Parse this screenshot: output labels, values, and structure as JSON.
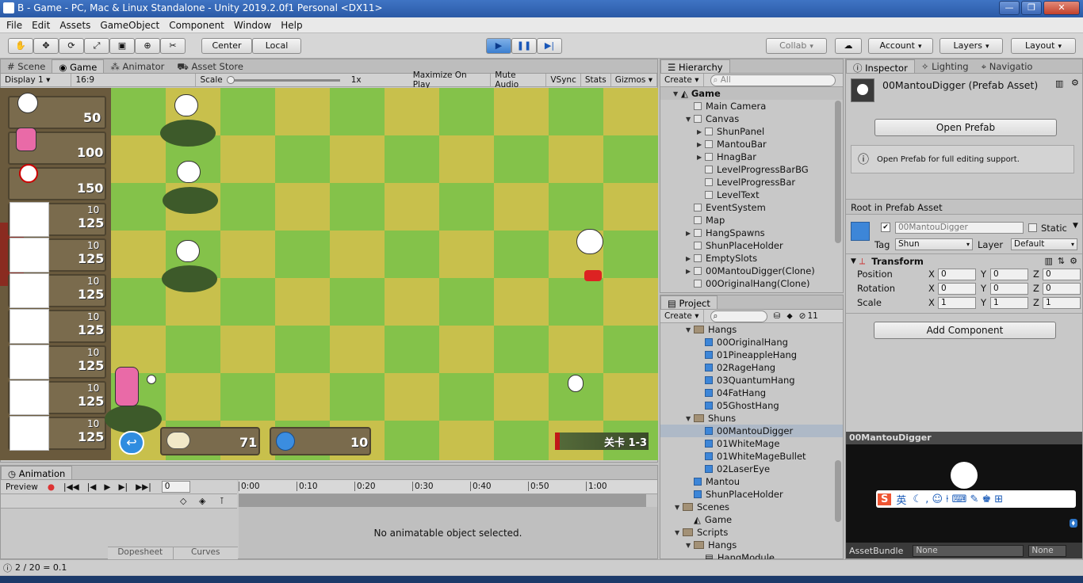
{
  "window": {
    "title": "B - Game - PC, Mac & Linux Standalone - Unity 2019.2.0f1 Personal <DX11>"
  },
  "menu": [
    "File",
    "Edit",
    "Assets",
    "GameObject",
    "Component",
    "Window",
    "Help"
  ],
  "toolbar": {
    "center": "Center",
    "local": "Local",
    "collab": "Collab",
    "account": "Account",
    "layers": "Layers",
    "layout": "Layout"
  },
  "scene_tabs": [
    "Scene",
    "Game",
    "Animator",
    "Asset Store"
  ],
  "game_bar": {
    "display": "Display 1",
    "aspect": "16:9",
    "scale_label": "Scale",
    "scale_value": "1x",
    "maximize": "Maximize On Play",
    "mute": "Mute Audio",
    "vsync": "VSync",
    "stats": "Stats",
    "gizmos": "Gizmos"
  },
  "game": {
    "top_costs": [
      "50",
      "100",
      "150"
    ],
    "slot_rows": [
      {
        "top": "10",
        "bottom": "125"
      },
      {
        "top": "10",
        "bottom": "125"
      },
      {
        "top": "10",
        "bottom": "125"
      },
      {
        "top": "10",
        "bottom": "125"
      },
      {
        "top": "10",
        "bottom": "125"
      },
      {
        "top": "10",
        "bottom": "125"
      },
      {
        "top": "10",
        "bottom": "125"
      }
    ],
    "resource_mantou": "71",
    "resource_energy": "10",
    "level_text": "关卡 1-3",
    "level_progress": 0.05
  },
  "animation": {
    "tab": "Animation",
    "preview": "Preview",
    "frame": "0",
    "time_ticks": [
      "0:00",
      "0:10",
      "0:20",
      "0:30",
      "0:40",
      "0:50",
      "1:00"
    ],
    "empty_message": "No animatable object selected.",
    "dopesheet": "Dopesheet",
    "curves": "Curves"
  },
  "hierarchy": {
    "tab": "Hierarchy",
    "create": "Create",
    "search_placeholder": "All",
    "scene": "Game",
    "items": [
      {
        "label": "Main Camera",
        "indent": 1,
        "arrow": ""
      },
      {
        "label": "Canvas",
        "indent": 1,
        "arrow": "▼"
      },
      {
        "label": "ShunPanel",
        "indent": 2,
        "arrow": "▶"
      },
      {
        "label": "MantouBar",
        "indent": 2,
        "arrow": "▶"
      },
      {
        "label": "HnagBar",
        "indent": 2,
        "arrow": "▶"
      },
      {
        "label": "LevelProgressBarBG",
        "indent": 2,
        "arrow": ""
      },
      {
        "label": "LevelProgressBar",
        "indent": 2,
        "arrow": ""
      },
      {
        "label": "LevelText",
        "indent": 2,
        "arrow": ""
      },
      {
        "label": "EventSystem",
        "indent": 1,
        "arrow": ""
      },
      {
        "label": "Map",
        "indent": 1,
        "arrow": ""
      },
      {
        "label": "HangSpawns",
        "indent": 1,
        "arrow": "▶"
      },
      {
        "label": "ShunPlaceHolder",
        "indent": 1,
        "arrow": ""
      },
      {
        "label": "EmptySlots",
        "indent": 1,
        "arrow": "▶"
      },
      {
        "label": "00MantouDigger(Clone)",
        "indent": 1,
        "arrow": "▶"
      },
      {
        "label": "00OriginalHang(Clone)",
        "indent": 1,
        "arrow": ""
      }
    ]
  },
  "project": {
    "tab": "Project",
    "create": "Create",
    "count": "11",
    "items": [
      {
        "label": "Hangs",
        "indent": 1,
        "type": "folder",
        "arrow": "▼"
      },
      {
        "label": "00OriginalHang",
        "indent": 2,
        "type": "prefab",
        "arrow": ""
      },
      {
        "label": "01PineappleHang",
        "indent": 2,
        "type": "prefab",
        "arrow": ""
      },
      {
        "label": "02RageHang",
        "indent": 2,
        "type": "prefab",
        "arrow": ""
      },
      {
        "label": "03QuantumHang",
        "indent": 2,
        "type": "prefab",
        "arrow": ""
      },
      {
        "label": "04FatHang",
        "indent": 2,
        "type": "prefab",
        "arrow": ""
      },
      {
        "label": "05GhostHang",
        "indent": 2,
        "type": "prefab",
        "arrow": ""
      },
      {
        "label": "Shuns",
        "indent": 1,
        "type": "folder",
        "arrow": "▼"
      },
      {
        "label": "00MantouDigger",
        "indent": 2,
        "type": "prefab",
        "arrow": "",
        "selected": true
      },
      {
        "label": "01WhiteMage",
        "indent": 2,
        "type": "prefab",
        "arrow": ""
      },
      {
        "label": "01WhiteMageBullet",
        "indent": 2,
        "type": "prefab",
        "arrow": ""
      },
      {
        "label": "02LaserEye",
        "indent": 2,
        "type": "prefab",
        "arrow": ""
      },
      {
        "label": "Mantou",
        "indent": 1,
        "type": "prefab",
        "arrow": ""
      },
      {
        "label": "ShunPlaceHolder",
        "indent": 1,
        "type": "prefab",
        "arrow": ""
      },
      {
        "label": "Scenes",
        "indent": 0,
        "type": "folder",
        "arrow": "▼"
      },
      {
        "label": "Game",
        "indent": 1,
        "type": "unity",
        "arrow": ""
      },
      {
        "label": "Scripts",
        "indent": 0,
        "type": "folder",
        "arrow": "▼"
      },
      {
        "label": "Hangs",
        "indent": 1,
        "type": "folder",
        "arrow": "▼"
      },
      {
        "label": "HangModule",
        "indent": 2,
        "type": "script",
        "arrow": ""
      }
    ]
  },
  "inspector": {
    "tabs": [
      "Inspector",
      "Lighting",
      "Navigatio"
    ],
    "title": "00MantouDigger (Prefab Asset)",
    "open_prefab": "Open Prefab",
    "help": "Open Prefab for full editing support.",
    "root_label": "Root in Prefab Asset",
    "name": "00MantouDigger",
    "static": "Static",
    "tag_label": "Tag",
    "tag": "Shun",
    "layer_label": "Layer",
    "layer": "Default",
    "transform": "Transform",
    "position": {
      "label": "Position",
      "x": "0",
      "y": "0",
      "z": "0"
    },
    "rotation": {
      "label": "Rotation",
      "x": "0",
      "y": "0",
      "z": "0"
    },
    "scale": {
      "label": "Scale",
      "x": "1",
      "y": "1",
      "z": "1"
    },
    "add_component": "Add Component",
    "preview_title": "00MantouDigger",
    "assetbundle_label": "AssetBundle",
    "assetbundle": "None",
    "assetbundle_variant": "None",
    "ime": "英"
  },
  "status": {
    "text": "2 / 20 = 0.1"
  }
}
